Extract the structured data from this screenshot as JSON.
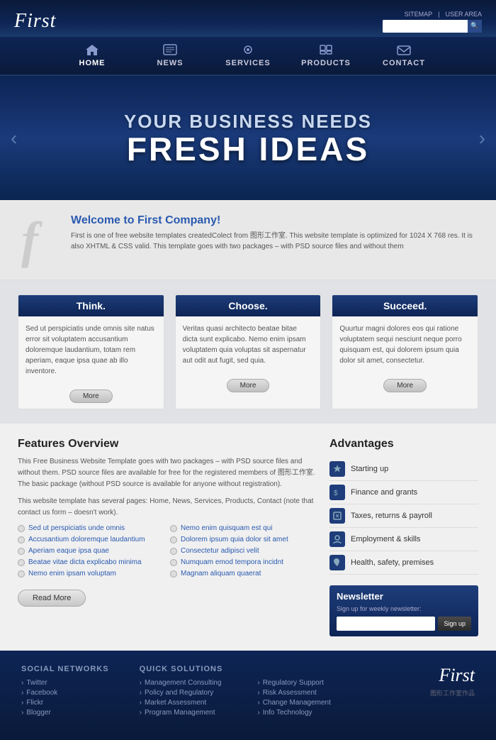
{
  "header": {
    "logo": "First",
    "links": [
      "SITEMAP",
      "USER AREA"
    ],
    "search_placeholder": ""
  },
  "nav": {
    "items": [
      {
        "label": "HOME",
        "icon": "home"
      },
      {
        "label": "NEWS",
        "icon": "news"
      },
      {
        "label": "SERVICES",
        "icon": "services"
      },
      {
        "label": "PRODUCTS",
        "icon": "products"
      },
      {
        "label": "CONTACT",
        "icon": "contact"
      }
    ]
  },
  "hero": {
    "line1": "YOUR BUSINESS NEEDS",
    "line2": "FRESH IDEAS"
  },
  "welcome": {
    "number": "f",
    "heading": "Welcome to ",
    "company": "First Company",
    "exclaim": "!",
    "text": "First is one of free website templates createdColect from 图形工作室. This website template is optimized for 1024 X 768 res. It is also XHTML & CSS valid. This template goes with two packages – with PSD source files and without them"
  },
  "cards": [
    {
      "title": "Think.",
      "body": "Sed ut perspiciatis unde omnis site natus error sit voluptatem accusantium doloremque laudantium, totam rem aperiam, eaque ipsa quae ab illo inventore.",
      "button": "More"
    },
    {
      "title": "Choose.",
      "body": "Veritas quasi architecto beatae bitae dicta sunt explicabo. Nemo enim ipsam voluptatem quia voluptas sit aspernatur aut odit aut fugit, sed quia.",
      "button": "More"
    },
    {
      "title": "Succeed.",
      "body": "Quurtur magni dolores eos qui ratione voluptatem sequi nesciunt neque porro quisquam est, qui dolorem ipsum quia dolor sit amet, consectetur.",
      "button": "More"
    }
  ],
  "features": {
    "title": "Features Overview",
    "desc1": "This Free Business Website Template goes with two packages – with PSD source files and without them. PSD source files are available for free for the registered members of 图形工作室. The basic package (without PSD source is available for anyone without registration).",
    "desc2": "This website template has several pages: Home, News, Services, Products, Contact (note that contact us form – doesn't work).",
    "list_left": [
      "Sed ut perspiciatis unde omnis",
      "Accusantium doloremque laudantium",
      "Aperiam eaque ipsa quae",
      "Beatae vitae dicta explicabo minima",
      "Nemo enim ipsam voluptam"
    ],
    "list_right": [
      "Nemo enim quisquam est qui",
      "Dolorem ipsum quia dolor sit amet",
      "Consectetur adipisci velit",
      "Numquam emod tempora incidnt",
      "Magnam aliquam quaerat"
    ],
    "read_more": "Read More"
  },
  "advantages": {
    "title": "Advantages",
    "items": [
      "Starting up",
      "Finance and grants",
      "Taxes, returns & payroll",
      "Employment & skills",
      "Health, safety, premises"
    ]
  },
  "newsletter": {
    "title": "Newsletter",
    "desc": "Sign up for weekly newsletter:",
    "placeholder": "",
    "button": "Sign up"
  },
  "footer": {
    "logo": "First",
    "logo_sub": "图形工作室作品",
    "social_title": "Social Networks",
    "social_links": [
      "Twitter",
      "Facebook",
      "Flickr",
      "Blogger"
    ],
    "solutions_title": "Quick Solutions",
    "solutions_links": [
      "Management Consulting",
      "Policy and Regulatory",
      "Market Assessment",
      "Program Management"
    ],
    "solutions2_links": [
      "Regulatory Support",
      "Risk Assessment",
      "Change Management",
      "Info Technology"
    ]
  }
}
